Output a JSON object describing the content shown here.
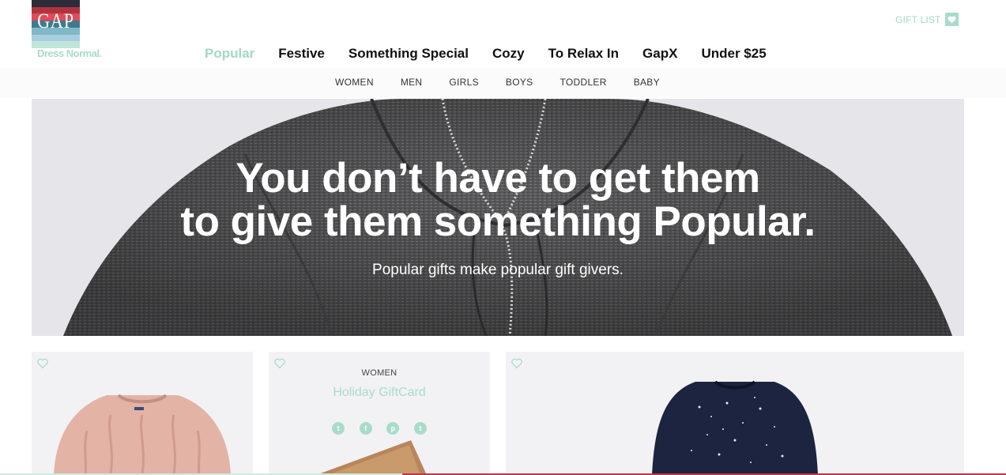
{
  "brand": {
    "logo_text": "GAP",
    "tagline": "Dress Normal.",
    "stripe_colors": [
      "#2b2b3a",
      "#b0343f",
      "#e2495a",
      "#3f7b8c",
      "#7fb9c9",
      "#a9cde0",
      "#bfe6d8"
    ]
  },
  "header": {
    "gift_list_label": "GIFT LIST",
    "gift_list_icon": "heart-icon"
  },
  "nav_primary": [
    {
      "label": "Popular",
      "active": true
    },
    {
      "label": "Festive",
      "active": false
    },
    {
      "label": "Something Special",
      "active": false
    },
    {
      "label": "Cozy",
      "active": false
    },
    {
      "label": "To Relax In",
      "active": false
    },
    {
      "label": "GapX",
      "active": false
    },
    {
      "label": "Under $25",
      "active": false
    }
  ],
  "nav_sub": [
    "WOMEN",
    "MEN",
    "GIRLS",
    "BOYS",
    "TODDLER",
    "BABY"
  ],
  "hero": {
    "headline_line1": "You don’t have to get them",
    "headline_line2": "to give them something Popular.",
    "subheadline": "Popular gifts make popular gift givers."
  },
  "cards": {
    "gift_card": {
      "category": "WOMEN",
      "title": "Holiday GiftCard",
      "social_icons": [
        "twitter-icon",
        "facebook-icon",
        "pinterest-icon",
        "tumblr-icon"
      ],
      "social_glyphs": [
        "t",
        "f",
        "p",
        "t"
      ]
    }
  },
  "colors": {
    "accent_mint": "#a8dcc9",
    "text_dark": "#111111"
  }
}
